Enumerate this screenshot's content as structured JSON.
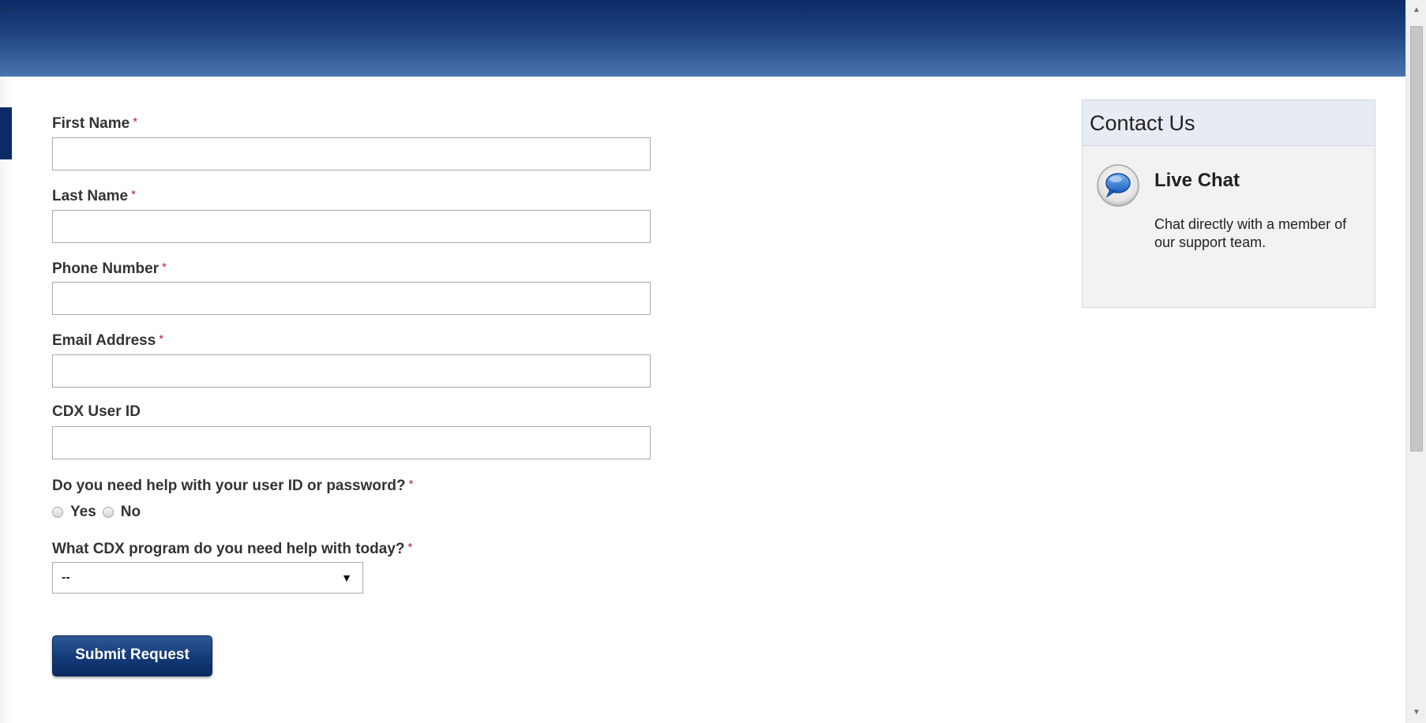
{
  "header": {
    "corner_glyph": ">"
  },
  "form": {
    "required_marker": "*",
    "fields": {
      "first_name": {
        "label": "First Name",
        "value": "",
        "required": true
      },
      "last_name": {
        "label": "Last Name",
        "value": "",
        "required": true
      },
      "phone": {
        "label": "Phone Number",
        "value": "",
        "required": true
      },
      "email": {
        "label": "Email Address",
        "value": "",
        "required": true
      },
      "cdx_user_id": {
        "label": "CDX User ID",
        "value": "",
        "required": false
      }
    },
    "help_question": {
      "label": "Do you need help with your user ID or password?",
      "required": true,
      "options": [
        "Yes",
        "No"
      ],
      "selected": null
    },
    "program_question": {
      "label": "What CDX program do you need help with today?",
      "required": true,
      "selected": "--"
    },
    "submit_label": "Submit Request"
  },
  "contact": {
    "title": "Contact Us",
    "chat_title": "Live Chat",
    "chat_description": "Chat directly with a member of our support team."
  },
  "icons": {
    "select_arrow": "chevron-down-icon",
    "chat": "chat-bubble-icon",
    "scroll_up": "scroll-up-icon",
    "scroll_down": "scroll-down-icon"
  },
  "colors": {
    "header_dark": "#0c2a66",
    "header_light": "#4a74ad",
    "required_asterisk": "#b1222a",
    "button_bg": "#133a78",
    "panel_bg": "#f2f2f2",
    "panel_header_bg": "#e7ecf4"
  }
}
